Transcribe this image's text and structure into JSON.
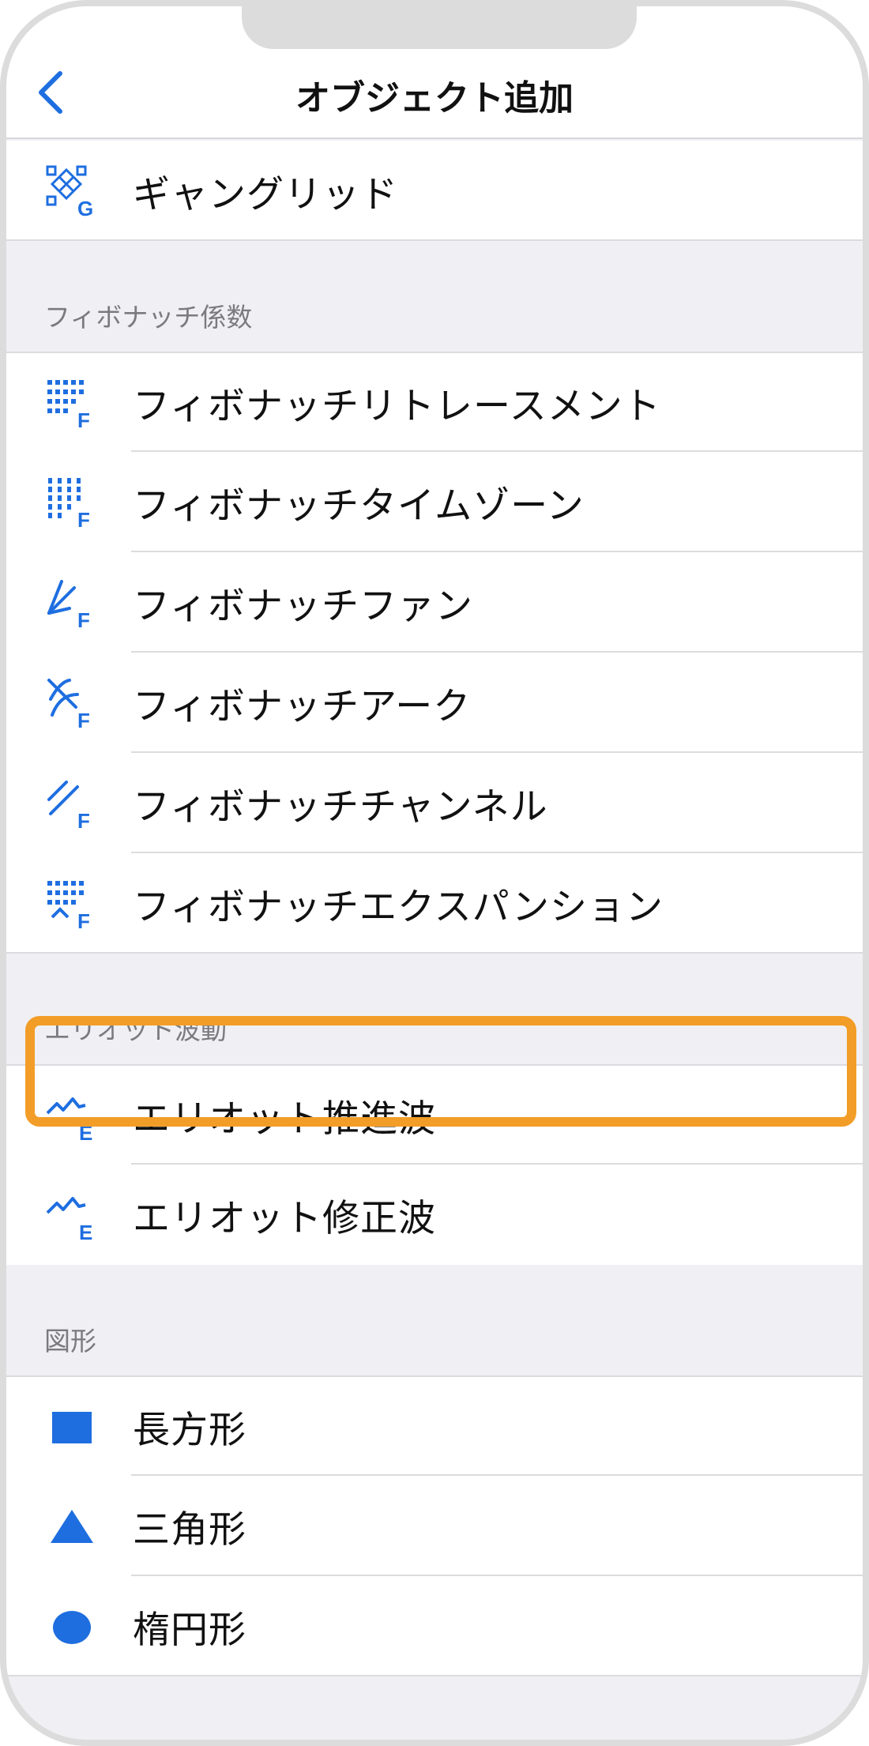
{
  "nav": {
    "title": "オブジェクト追加",
    "back_icon": "chevron-left-icon"
  },
  "accent_color": "#1e6ee0",
  "highlight_color": "#f29d28",
  "top_item": {
    "label": "ギャングリッド",
    "icon": "gann-grid-icon"
  },
  "sections": [
    {
      "header": "フィボナッチ係数",
      "items": [
        {
          "label": "フィボナッチリトレースメント",
          "icon": "fibo-retracement-icon"
        },
        {
          "label": "フィボナッチタイムゾーン",
          "icon": "fibo-timezone-icon"
        },
        {
          "label": "フィボナッチファン",
          "icon": "fibo-fan-icon"
        },
        {
          "label": "フィボナッチアーク",
          "icon": "fibo-arc-icon"
        },
        {
          "label": "フィボナッチチャンネル",
          "icon": "fibo-channel-icon"
        },
        {
          "label": "フィボナッチエクスパンション",
          "icon": "fibo-expansion-icon"
        }
      ]
    },
    {
      "header": "エリオット波動",
      "items": [
        {
          "label": "エリオット推進波",
          "icon": "elliott-impulse-icon"
        },
        {
          "label": "エリオット修正波",
          "icon": "elliott-correction-icon",
          "highlighted": true
        }
      ]
    },
    {
      "header": "図形",
      "items": [
        {
          "label": "長方形",
          "icon": "rectangle-icon"
        },
        {
          "label": "三角形",
          "icon": "triangle-icon"
        },
        {
          "label": "楕円形",
          "icon": "ellipse-icon"
        }
      ]
    }
  ]
}
